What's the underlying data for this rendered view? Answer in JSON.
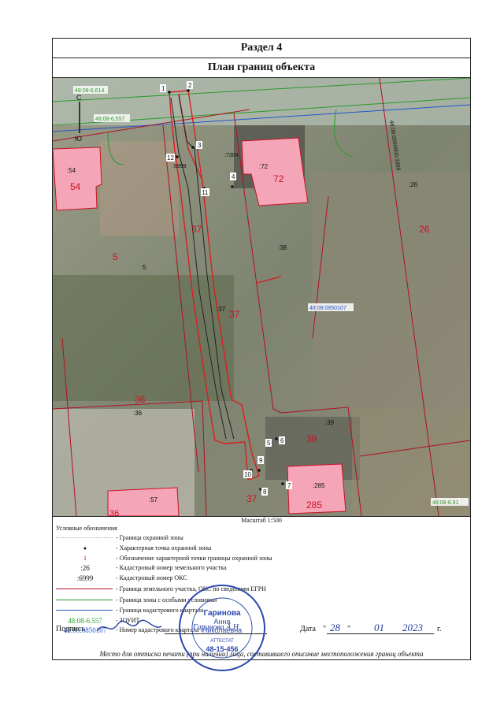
{
  "section_title": "Раздел 4",
  "plan_title": "План границ объекта",
  "scale_text": "Масштаб 1:500",
  "legend_heading": "Условные обозначения",
  "legend": {
    "guard_zone_border": "- Граница охранной зоны",
    "guard_point_symbol": "●",
    "guard_point": "- Характерная точка охранной зоны",
    "point_label_symbol": "1",
    "point_label": "- Обозначение характерной точки границы охранной зоны",
    "parcel_number_symbol": ":26",
    "parcel_number": "- Кадастровый номер земельного участка",
    "oks_number_symbol": ":6999",
    "oks_number": "- Кадастровый номер ОКС",
    "parcel_border": "- Граница земельного участка, ОКС по сведениям ЕГРН",
    "special_zone_border": "- Граница зоны с особыми условиями",
    "quarter_border": "- Граница кадастрового квартала",
    "zouit_symbol": "48:08-6.557",
    "zouit": "- ЗОУИТ",
    "quarter_number_symbol": "48:08:0850107",
    "quarter_number": "- Номер кадастрового квартала"
  },
  "signature": {
    "label": "Подпись",
    "name": "Гаринова А.Н.",
    "date_label": "Дата",
    "day": "28",
    "month": "01",
    "year": "2023",
    "year_suffix": "г."
  },
  "footer": "Место для оттиска печати (при наличии) лица, составившего описание местоположения границ объекта",
  "stamp": {
    "name_line1": "Гаринова",
    "name_line2": "Анна",
    "name_line3": "Николаевна",
    "subtitle": "АТТЕСТАТ",
    "cert_number": "48-15-456"
  },
  "map": {
    "north_arrow": "С",
    "south_arrow": "Ю",
    "zone_label_top": "48:08-6.614",
    "zone_label_2": "48:08-6.557",
    "zone_label_bottom_right": "48:08-6.91",
    "quarter_label": "48:08:0850107",
    "quarter_label_rotated": "48:08:0000000:3359",
    "oks_label": ":6999",
    "oks_label_2": ":7304",
    "parcels": [
      {
        "code": ":54",
        "num": "54"
      },
      {
        "code": ":72",
        "num": "72"
      },
      {
        "code": ":26",
        "num": "26"
      },
      {
        "code": ":5",
        "num": "5"
      },
      {
        "code": ":37",
        "num": "37"
      },
      {
        "code": ":38",
        "num": "38"
      },
      {
        "code": ":36",
        "num": "36"
      },
      {
        "code": ":39",
        "num": "39"
      },
      {
        "code": ":285",
        "num": "285"
      },
      {
        "code": ":57",
        "num": "57"
      }
    ],
    "points": [
      "1",
      "2",
      "3",
      "4",
      "5",
      "6",
      "7",
      "8",
      "9",
      "10",
      "11",
      "12"
    ]
  },
  "colors": {
    "parcel_fill": "#f4a6b8",
    "parcel_label": "#cc1122",
    "zone_line": "#2a9a2a",
    "quarter_line": "#2255cc",
    "guard_line": "#d62020",
    "parcel_line": "#b01020"
  }
}
